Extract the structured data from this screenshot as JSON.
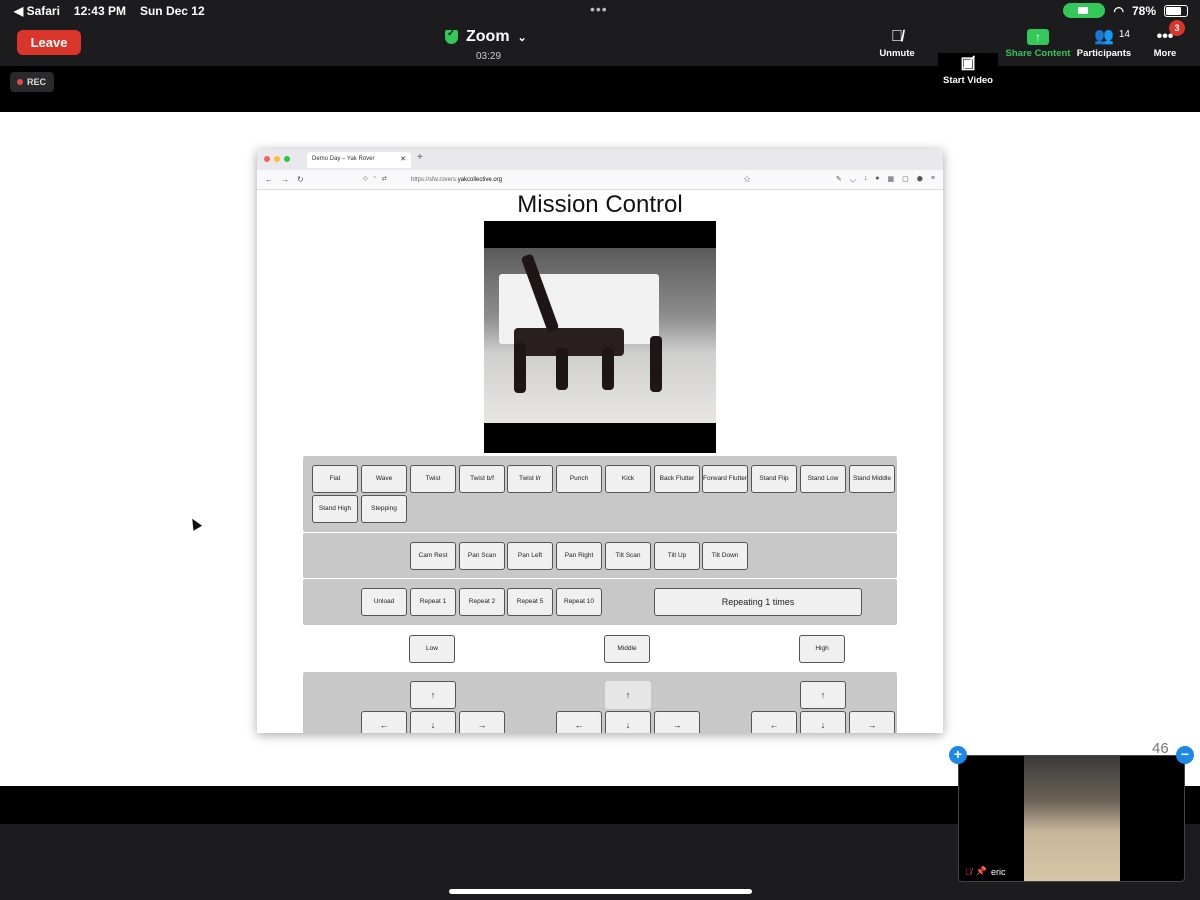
{
  "status_bar": {
    "back_app": "◀ Safari",
    "time": "12:43 PM",
    "date": "Sun Dec 12",
    "battery": "78%",
    "battery_level": 0.78
  },
  "zoom": {
    "leave": "Leave",
    "title": "Zoom",
    "timer": "03:29",
    "unmute": "Unmute",
    "start_video": "Start Video",
    "share_content": "Share Content",
    "participants": "Participants",
    "participant_count": "14",
    "more": "More",
    "more_badge": "3",
    "rec": "REC",
    "accent": "#34c759",
    "leave_color": "#d9352b"
  },
  "browser": {
    "tab_title": "Demo Day – Yak Rover",
    "url_prefix": "https://sfw.rovers.",
    "url_domain": "yakcollective.org"
  },
  "mission": {
    "title": "Mission Control",
    "gaits": [
      "Flat",
      "Wave",
      "Twist",
      "Twist b/f",
      "Twist l/r",
      "Punch",
      "Kick",
      "Back Flutter",
      "Forward Flutter",
      "Stand Flip",
      "Stand Low",
      "Stand Middle",
      "Stand High",
      "Stepping"
    ],
    "camera": [
      "Cam Rest",
      "Pan Scan",
      "Pan Left",
      "Pan Right",
      "Tilt Scan",
      "Tilt Up",
      "Tilt Down"
    ],
    "repeat": [
      "Unload",
      "Repeat 1",
      "Repeat 2",
      "Repeat 5",
      "Repeat 10"
    ],
    "repeat_status": "Repeating 1 times",
    "heights": [
      "Low",
      "Middle",
      "High"
    ],
    "arrow_up": "↑",
    "arrow_left": "←",
    "arrow_down": "↓",
    "arrow_right": "→"
  },
  "slide": {
    "page_number": "46"
  },
  "thumbnail": {
    "name": "eric"
  }
}
